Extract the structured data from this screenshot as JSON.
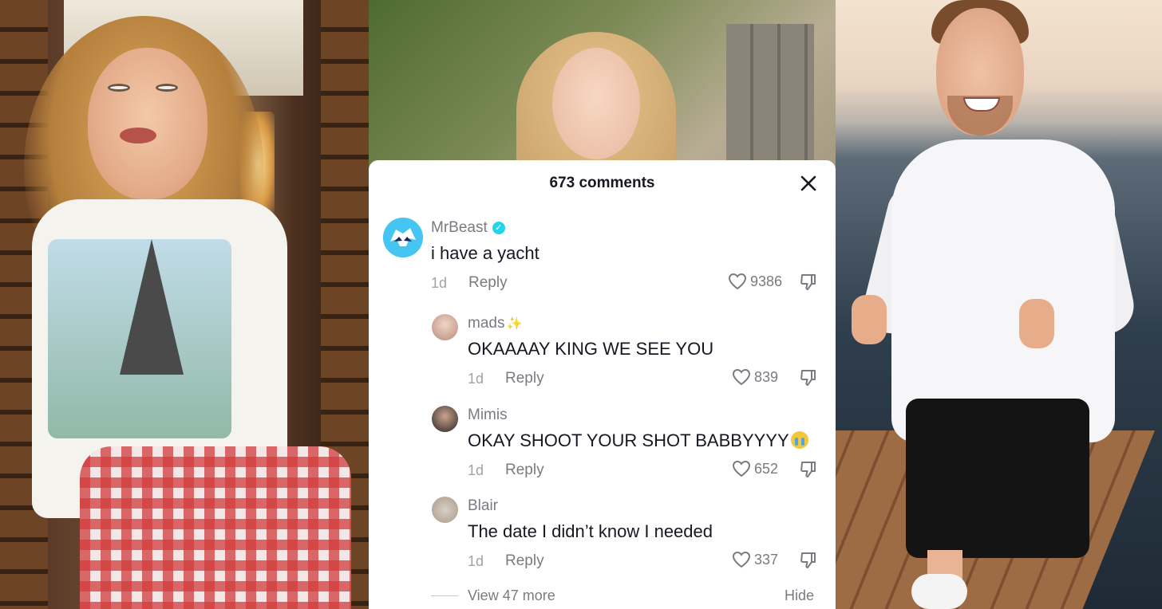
{
  "comments_panel": {
    "count_label": "673 comments",
    "close_icon": "close-icon",
    "view_more": "View 47 more",
    "hide": "Hide"
  },
  "comments": [
    {
      "username": "MrBeast",
      "verified": true,
      "text": "i have a yacht",
      "time": "1d",
      "reply_label": "Reply",
      "likes": "9386"
    },
    {
      "username": "mads",
      "decoration": "✨",
      "text": "OKAAAAY KING WE SEE YOU",
      "time": "1d",
      "reply_label": "Reply",
      "likes": "839"
    },
    {
      "username": "Mimis",
      "text": "OKAY SHOOT YOUR SHOT BABBYYYY",
      "emoji": "crying-face",
      "time": "1d",
      "reply_label": "Reply",
      "likes": "652"
    },
    {
      "username": "Blair",
      "text": "The date I didn’t know I needed",
      "time": "1d",
      "reply_label": "Reply",
      "likes": "337"
    }
  ],
  "colors": {
    "verified_badge": "#20d5ec",
    "primary_text": "#161823",
    "secondary_text": "#7a7b82"
  }
}
